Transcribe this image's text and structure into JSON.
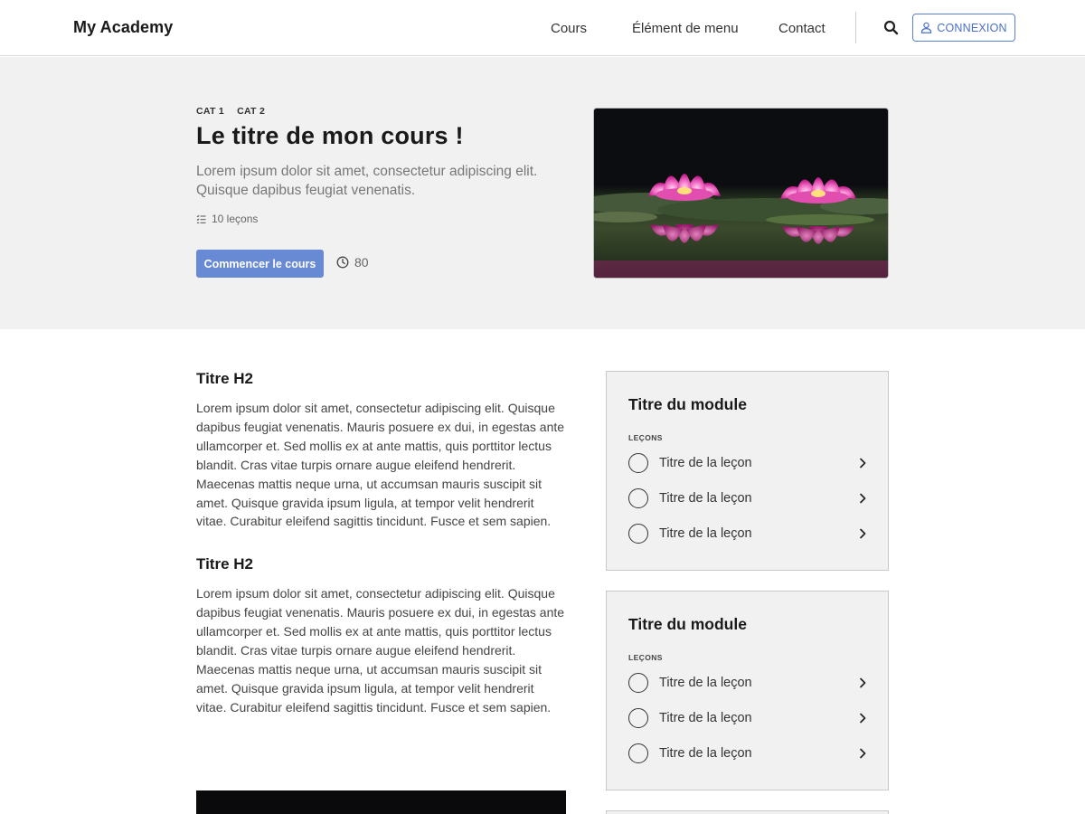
{
  "header": {
    "brand": "My Academy",
    "nav": [
      "Cours",
      "Élément de menu",
      "Contact"
    ],
    "login_label": "CONNEXION"
  },
  "hero": {
    "categories": [
      "CAT 1",
      "CAT 2"
    ],
    "title": "Le titre de mon cours !",
    "description": "Lorem ipsum dolor sit amet, consectetur adipiscing elit. Quisque dapibus feugiat venenatis.",
    "lessons_count": "10 leçons",
    "start_label": "Commencer le cours",
    "duration": "80"
  },
  "article": {
    "sections": [
      {
        "heading": "Titre H2",
        "text": "Lorem ipsum dolor sit amet, consectetur adipiscing elit. Quisque dapibus feugiat venenatis. Mauris posuere ex dui, in egestas ante ullamcorper et. Sed mollis ex at ante mattis, quis porttitor lectus blandit. Cras vitae turpis ornare augue eleifend hendrerit. Maecenas mattis neque urna, ut accumsan mauris suscipit sit amet. Quisque gravida ipsum ligula, at tempor velit hendrerit vitae. Curabitur eleifend sagittis tincidunt. Fusce et sem sapien."
      },
      {
        "heading": "Titre H2",
        "text": "Lorem ipsum dolor sit amet, consectetur adipiscing elit. Quisque dapibus feugiat venenatis. Mauris posuere ex dui, in egestas ante ullamcorper et. Sed mollis ex at ante mattis, quis porttitor lectus blandit. Cras vitae turpis ornare augue eleifend hendrerit. Maecenas mattis neque urna, ut accumsan mauris suscipit sit amet. Quisque gravida ipsum ligula, at tempor velit hendrerit vitae. Curabitur eleifend sagittis tincidunt. Fusce et sem sapien."
      }
    ]
  },
  "modules": [
    {
      "title": "Titre du module",
      "lessons_label": "LEÇONS",
      "lessons": [
        "Titre de la leçon",
        "Titre de la leçon",
        "Titre de la leçon"
      ]
    },
    {
      "title": "Titre du module",
      "lessons_label": "LEÇONS",
      "lessons": [
        "Titre de la leçon",
        "Titre de la leçon",
        "Titre de la leçon"
      ]
    }
  ],
  "icons": {
    "search": "search-icon",
    "user": "user-icon",
    "list": "list-icon",
    "clock": "clock-icon",
    "chevron": "chevron-right-icon"
  },
  "colors": {
    "accent": "#6889d4",
    "login_border": "#5b7fd4",
    "hero_bg": "#f1f1f1",
    "module_bg": "#f1f1f1"
  }
}
